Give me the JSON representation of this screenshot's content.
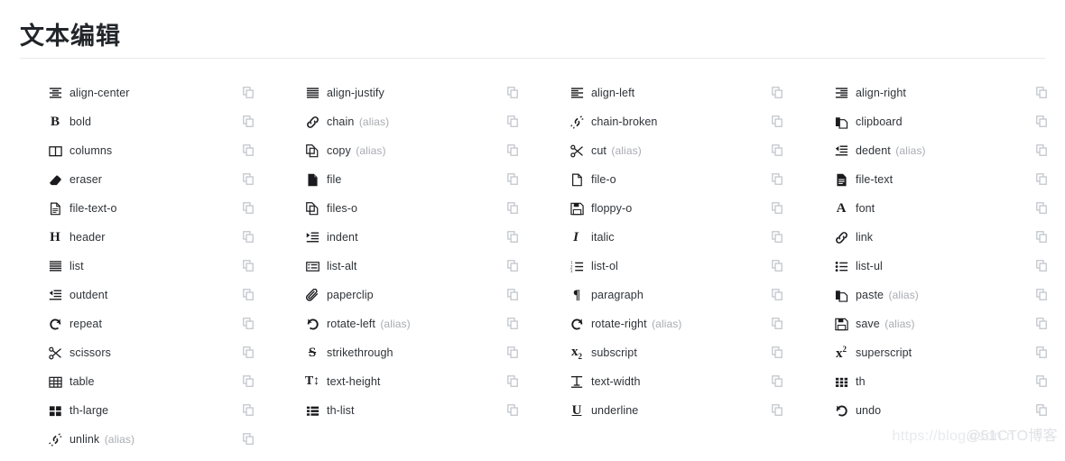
{
  "header": {
    "title": "文本编辑"
  },
  "copy_button": {
    "icon": "copy-icon",
    "label": ""
  },
  "alias_suffix": "(alias)",
  "columns": [
    {
      "name": "column-1",
      "items": [
        {
          "icon": "align-center-icon",
          "label": "align-center",
          "alias": ""
        },
        {
          "icon": "bold-icon",
          "label": "bold",
          "alias": ""
        },
        {
          "icon": "columns-icon",
          "label": "columns",
          "alias": ""
        },
        {
          "icon": "eraser-icon",
          "label": "eraser",
          "alias": ""
        },
        {
          "icon": "file-text-o-icon",
          "label": "file-text-o",
          "alias": ""
        },
        {
          "icon": "header-icon",
          "label": "header",
          "alias": ""
        },
        {
          "icon": "list-icon",
          "label": "list",
          "alias": ""
        },
        {
          "icon": "outdent-icon",
          "label": "outdent",
          "alias": ""
        },
        {
          "icon": "repeat-icon",
          "label": "repeat",
          "alias": ""
        },
        {
          "icon": "scissors-icon",
          "label": "scissors",
          "alias": ""
        },
        {
          "icon": "table-icon",
          "label": "table",
          "alias": ""
        },
        {
          "icon": "th-large-icon",
          "label": "th-large",
          "alias": ""
        },
        {
          "icon": "unlink-icon",
          "label": "unlink",
          "alias": "(alias)"
        }
      ]
    },
    {
      "name": "column-2",
      "items": [
        {
          "icon": "align-justify-icon",
          "label": "align-justify",
          "alias": ""
        },
        {
          "icon": "chain-icon",
          "label": "chain",
          "alias": "(alias)"
        },
        {
          "icon": "copy-icon",
          "label": "copy",
          "alias": "(alias)"
        },
        {
          "icon": "file-icon",
          "label": "file",
          "alias": ""
        },
        {
          "icon": "files-o-icon",
          "label": "files-o",
          "alias": ""
        },
        {
          "icon": "indent-icon",
          "label": "indent",
          "alias": ""
        },
        {
          "icon": "list-alt-icon",
          "label": "list-alt",
          "alias": ""
        },
        {
          "icon": "paperclip-icon",
          "label": "paperclip",
          "alias": ""
        },
        {
          "icon": "rotate-left-icon",
          "label": "rotate-left",
          "alias": "(alias)"
        },
        {
          "icon": "strikethrough-icon",
          "label": "strikethrough",
          "alias": ""
        },
        {
          "icon": "text-height-icon",
          "label": "text-height",
          "alias": ""
        },
        {
          "icon": "th-list-icon",
          "label": "th-list",
          "alias": ""
        }
      ]
    },
    {
      "name": "column-3",
      "items": [
        {
          "icon": "align-left-icon",
          "label": "align-left",
          "alias": ""
        },
        {
          "icon": "chain-broken-icon",
          "label": "chain-broken",
          "alias": ""
        },
        {
          "icon": "cut-icon",
          "label": "cut",
          "alias": "(alias)"
        },
        {
          "icon": "file-o-icon",
          "label": "file-o",
          "alias": ""
        },
        {
          "icon": "floppy-o-icon",
          "label": "floppy-o",
          "alias": ""
        },
        {
          "icon": "italic-icon",
          "label": "italic",
          "alias": ""
        },
        {
          "icon": "list-ol-icon",
          "label": "list-ol",
          "alias": ""
        },
        {
          "icon": "paragraph-icon",
          "label": "paragraph",
          "alias": ""
        },
        {
          "icon": "rotate-right-icon",
          "label": "rotate-right",
          "alias": "(alias)"
        },
        {
          "icon": "subscript-icon",
          "label": "subscript",
          "alias": ""
        },
        {
          "icon": "text-width-icon",
          "label": "text-width",
          "alias": ""
        },
        {
          "icon": "underline-icon",
          "label": "underline",
          "alias": ""
        }
      ]
    },
    {
      "name": "column-4",
      "items": [
        {
          "icon": "align-right-icon",
          "label": "align-right",
          "alias": ""
        },
        {
          "icon": "clipboard-icon",
          "label": "clipboard",
          "alias": ""
        },
        {
          "icon": "dedent-icon",
          "label": "dedent",
          "alias": "(alias)"
        },
        {
          "icon": "file-text-icon",
          "label": "file-text",
          "alias": ""
        },
        {
          "icon": "font-icon",
          "label": "font",
          "alias": ""
        },
        {
          "icon": "link-icon",
          "label": "link",
          "alias": ""
        },
        {
          "icon": "list-ul-icon",
          "label": "list-ul",
          "alias": ""
        },
        {
          "icon": "paste-icon",
          "label": "paste",
          "alias": "(alias)"
        },
        {
          "icon": "save-icon",
          "label": "save",
          "alias": "(alias)"
        },
        {
          "icon": "superscript-icon",
          "label": "superscript",
          "alias": ""
        },
        {
          "icon": "th-icon",
          "label": "th",
          "alias": ""
        },
        {
          "icon": "undo-icon",
          "label": "undo",
          "alias": ""
        }
      ]
    }
  ],
  "watermark": {
    "url_text": "https://blog.csdn.n",
    "brand_text": "@51CTO博客"
  },
  "colors": {
    "title": "#22252a",
    "label": "#2f3338",
    "alias": "#a9acb2",
    "icon": "#1b1b1f",
    "copy_icon": "#bfc3c9",
    "rule": "#e9e9ec",
    "background": "#ffffff"
  }
}
